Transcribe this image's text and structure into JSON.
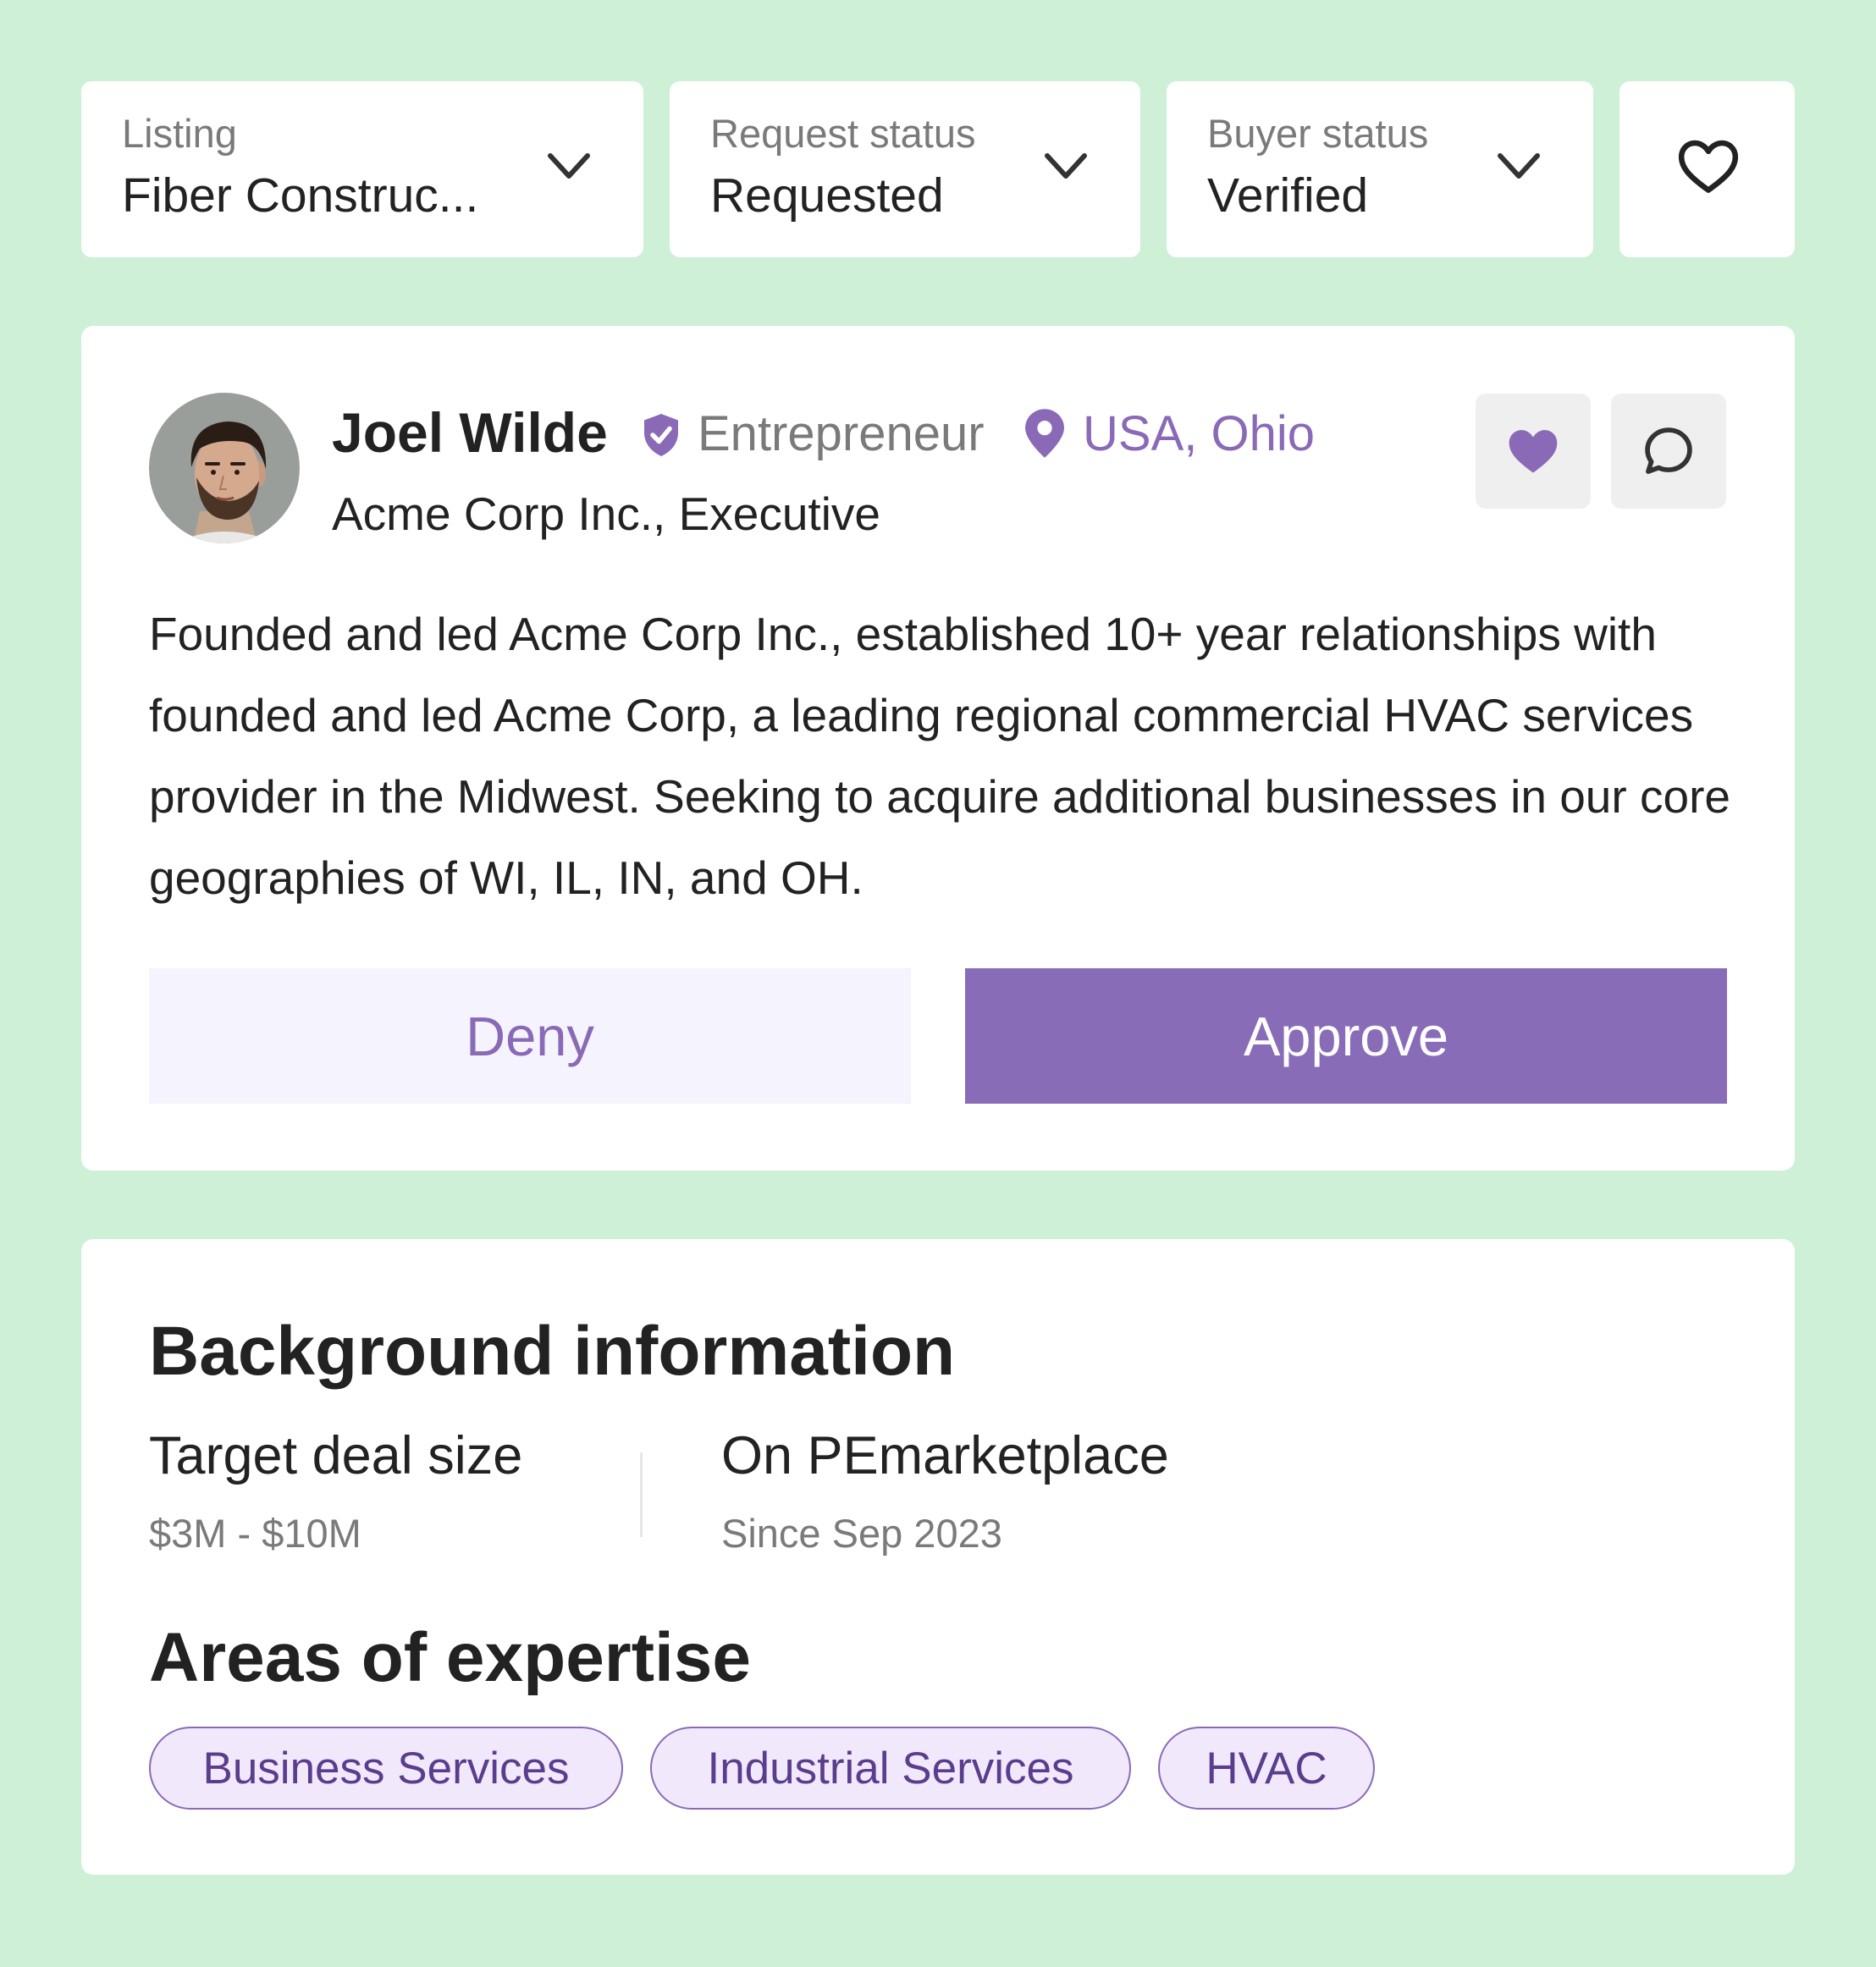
{
  "filters": {
    "listing": {
      "label": "Listing",
      "value": "Fiber Construc..."
    },
    "request_status": {
      "label": "Request status",
      "value": "Requested"
    },
    "buyer_status": {
      "label": "Buyer status",
      "value": "Verified"
    }
  },
  "profile": {
    "name": "Joel Wilde",
    "role": "Entrepreneur",
    "location": "USA, Ohio",
    "company": "Acme Corp Inc., Executive",
    "bio": "Founded and led Acme Corp Inc., established 10+ year relationships with founded and led Acme Corp, a leading regional commercial HVAC services provider in the Midwest. Seeking to acquire additional businesses in our core geographies of WI, IL, IN, and OH.",
    "deny_label": "Deny",
    "approve_label": "Approve"
  },
  "background": {
    "title": "Background information",
    "deal_size_label": "Target deal size",
    "deal_size_value": "$3M - $10M",
    "platform_label": "On PEmarketplace",
    "platform_value": "Since Sep 2023",
    "expertise_title": "Areas of expertise",
    "tags": [
      "Business Services",
      "Industrial Services",
      "HVAC"
    ]
  },
  "colors": {
    "page_background": "#cdf0d6",
    "accent": "#896cb8",
    "accent_light": "#f5f3fd",
    "tag_fill": "#f1e9fb"
  },
  "icons": [
    "chevron-down-icon",
    "heart-outline-icon",
    "verified-shield-icon",
    "location-pin-icon",
    "heart-filled-icon",
    "chat-bubble-icon"
  ]
}
